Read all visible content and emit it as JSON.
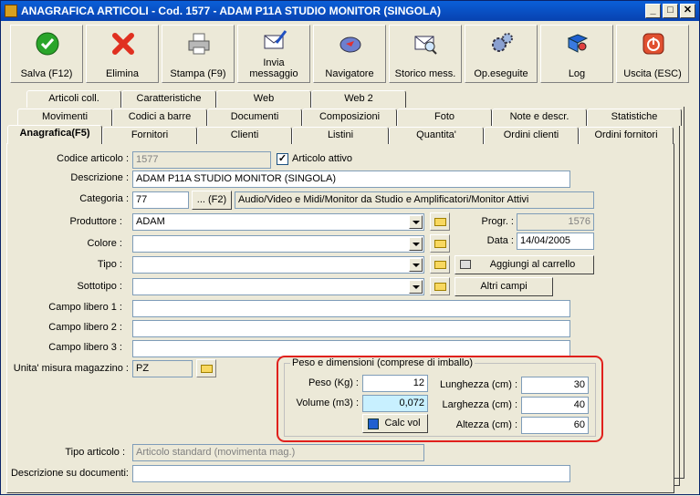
{
  "window": {
    "title": "ANAGRAFICA ARTICOLI - Cod. 1577 - ADAM P11A STUDIO MONITOR (SINGOLA)",
    "min": "_",
    "max": "□",
    "close": "✕"
  },
  "toolbar": [
    {
      "label": "Salva (F12)",
      "icon": "check-icon"
    },
    {
      "label": "Elimina",
      "icon": "delete-x-icon"
    },
    {
      "label": "Stampa (F9)",
      "icon": "printer-icon"
    },
    {
      "label": "Invia\nmessaggio",
      "icon": "envelope-pen-icon"
    },
    {
      "label": "Navigatore",
      "icon": "compass-icon"
    },
    {
      "label": "Storico mess.",
      "icon": "envelope-search-icon"
    },
    {
      "label": "Op.eseguite",
      "icon": "gears-icon"
    },
    {
      "label": "Log",
      "icon": "book-search-icon"
    },
    {
      "label": "Uscita (ESC)",
      "icon": "exit-icon"
    }
  ],
  "tabs_row1": [
    "Articoli coll.",
    "Caratteristiche",
    "Web",
    "Web 2"
  ],
  "tabs_row2": [
    "Movimenti",
    "Codici a barre",
    "Documenti",
    "Composizioni",
    "Foto",
    "Note e descr.",
    "Statistiche"
  ],
  "tabs_row3": [
    "Anagrafica(F5)",
    "Fornitori",
    "Clienti",
    "Listini",
    "Quantita'",
    "Ordini clienti",
    "Ordini fornitori"
  ],
  "form": {
    "codice_label": "Codice articolo :",
    "codice": "1577",
    "attivo_label": "Articolo attivo",
    "attivo_check": "✓",
    "descrizione_label": "Descrizione :",
    "descrizione": "ADAM P11A STUDIO MONITOR (SINGOLA)",
    "categoria_label": "Categoria :",
    "categoria": "77",
    "categoria_btn": "... (F2)",
    "categoria_desc": "Audio/Video e Midi/Monitor da Studio e Amplificatori/Monitor Attivi",
    "produttore_label": "Produttore :",
    "produttore": "ADAM",
    "colore_label": "Colore :",
    "colore": "",
    "tipo_label": "Tipo :",
    "tipo": "",
    "sottotipo_label": "Sottotipo :",
    "sottotipo": "",
    "progr_label": "Progr. :",
    "progr": "1576",
    "data_label": "Data :",
    "data": "14/04/2005",
    "carrello_btn": "Aggiungi al carrello",
    "altri_btn": "Altri campi",
    "libero1_label": "Campo libero 1 :",
    "libero2_label": "Campo libero 2 :",
    "libero3_label": "Campo libero 3 :",
    "um_label": "Unita' misura magazzino :",
    "um": "PZ",
    "tipo_articolo_label": "Tipo articolo :",
    "tipo_articolo": "Articolo standard (movimenta mag.)",
    "desc_doc_label": "Descrizione su documenti:"
  },
  "peso": {
    "title": "Peso e dimensioni (comprese di imballo)",
    "peso_label": "Peso (Kg) :",
    "peso": "12",
    "volume_label": "Volume (m3) :",
    "volume": "0,072",
    "calc_btn": "Calc vol",
    "lunghezza_label": "Lunghezza (cm) :",
    "lunghezza": "30",
    "larghezza_label": "Larghezza (cm) :",
    "larghezza": "40",
    "altezza_label": "Altezza (cm) :",
    "altezza": "60"
  }
}
